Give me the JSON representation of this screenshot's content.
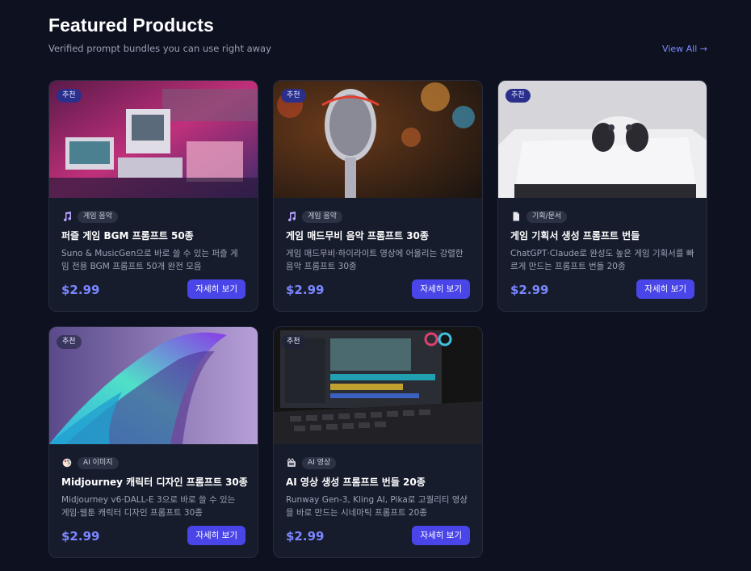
{
  "section": {
    "title": "Featured Products",
    "subtitle": "Verified prompt bundles you can use right away",
    "view_all": "View All →"
  },
  "colors": {
    "background": "#0d1120",
    "card": "#171c2c",
    "accent": "#4a45e8",
    "price": "#7b86ff"
  },
  "products": [
    {
      "badge": "추천",
      "icon": "music-note-icon",
      "category": "게임 음악",
      "title": "퍼즐 게임 BGM 프롬프트 50종",
      "desc": "Suno & MusicGen으로 바로 쓸 수 있는 퍼즐 게임 전용 BGM 프롬프트 50개 완전 모음",
      "price": "$2.99",
      "button": "자세히 보기"
    },
    {
      "badge": "추천",
      "icon": "music-note-icon",
      "category": "게임 음악",
      "title": "게임 매드무비 음악 프롬프트 30종",
      "desc": "게임 매드무비·하이라이트 영상에 어울리는 강렬한 음악 프롬프트 30종",
      "price": "$2.99",
      "button": "자세히 보기"
    },
    {
      "badge": "추천",
      "icon": "document-icon",
      "category": "기획/문서",
      "title": "게임 기획서 생성 프롬프트 번들",
      "desc": "ChatGPT·Claude로 완성도 높은 게임 기획서를 빠르게 만드는 프롬프트 번들 20종",
      "price": "$2.99",
      "button": "자세히 보기"
    },
    {
      "badge": "추천",
      "icon": "palette-icon",
      "category": "AI 이미지",
      "title": "Midjourney 캐릭터 디자인 프롬프트 30종",
      "desc": "Midjourney v6·DALL-E 3으로 바로 쓸 수 있는 게임·웹툰 캐릭터 디자인 프롬프트 30종",
      "price": "$2.99",
      "button": "자세히 보기"
    },
    {
      "badge": "추천",
      "icon": "video-icon",
      "category": "AI 영상",
      "title": "AI 영상 생성 프롬프트 번들 20종",
      "desc": "Runway Gen-3, Kling AI, Pika로 고퀄리티 영상을 바로 만드는 시네마틱 프롬프트 20종",
      "price": "$2.99",
      "button": "자세히 보기"
    }
  ]
}
